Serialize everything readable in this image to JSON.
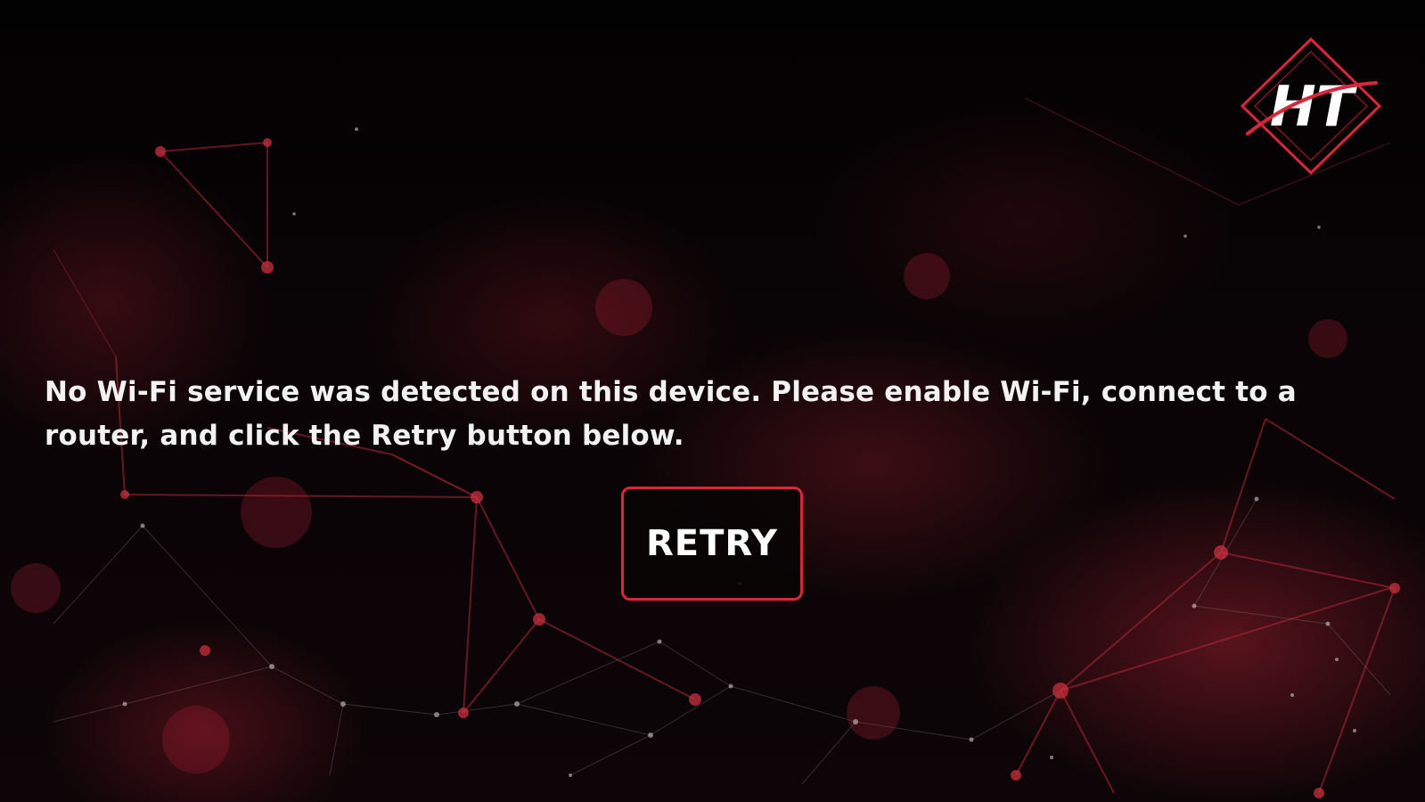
{
  "message": {
    "text": "No Wi-Fi service was detected on this device. Please enable Wi-Fi, connect to a router, and click the Retry button below."
  },
  "retry_button": {
    "label": "RETRY"
  },
  "logo": {
    "text": "HT",
    "icon": "ht-diamond-logo"
  },
  "theme": {
    "background": "#050304",
    "accent": "#d8263a",
    "text": "#f2f2f2"
  }
}
